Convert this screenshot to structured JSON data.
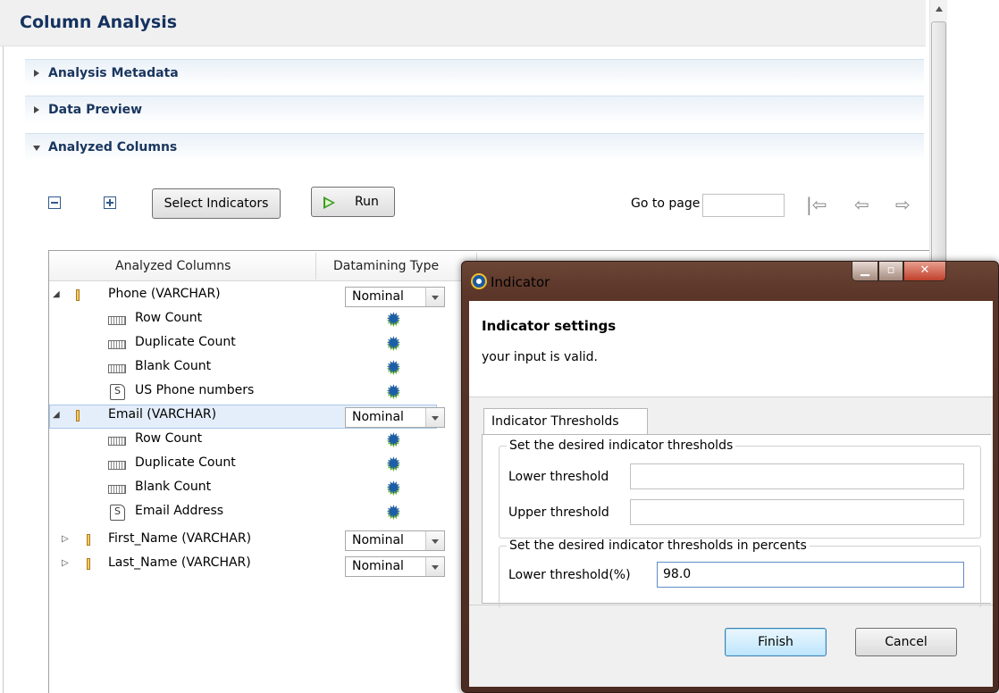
{
  "editor": {
    "title": "Column Analysis"
  },
  "sections": {
    "metadata": "Analysis Metadata",
    "preview": "Data Preview",
    "analyzed": "Analyzed Columns"
  },
  "toolbar": {
    "select_indicators": "Select Indicators",
    "run": "Run",
    "goto_label": "Go to page",
    "goto_value": ""
  },
  "table": {
    "headers": [
      "Analyzed Columns",
      "Datamining Type"
    ],
    "rows": [
      {
        "label": "Phone (VARCHAR)",
        "type": "column",
        "datamining": "Nominal"
      },
      {
        "label": "Row Count",
        "type": "indicator"
      },
      {
        "label": "Duplicate Count",
        "type": "indicator"
      },
      {
        "label": "Blank Count",
        "type": "indicator"
      },
      {
        "label": "US Phone numbers",
        "type": "pattern"
      },
      {
        "label": "Email (VARCHAR)",
        "type": "column",
        "datamining": "Nominal",
        "selected": true
      },
      {
        "label": "Row Count",
        "type": "indicator"
      },
      {
        "label": "Duplicate Count",
        "type": "indicator"
      },
      {
        "label": "Blank Count",
        "type": "indicator"
      },
      {
        "label": "Email Address",
        "type": "pattern"
      },
      {
        "label": "First_Name (VARCHAR)",
        "type": "column",
        "datamining": "Nominal"
      },
      {
        "label": "Last_Name (VARCHAR)",
        "type": "column",
        "datamining": "Nominal"
      }
    ]
  },
  "dialog": {
    "title": "Indicator",
    "heading": "Indicator settings",
    "message": "your input is valid.",
    "tab": "Indicator Thresholds",
    "group1": {
      "title": "Set the desired indicator thresholds",
      "lower_label": "Lower threshold",
      "lower_value": "",
      "upper_label": "Upper threshold",
      "upper_value": ""
    },
    "group2": {
      "title": "Set the desired indicator thresholds in percents",
      "lower_pct_label": "Lower threshold(%)",
      "lower_pct_value": "98.0"
    },
    "finish": "Finish",
    "cancel": "Cancel"
  }
}
